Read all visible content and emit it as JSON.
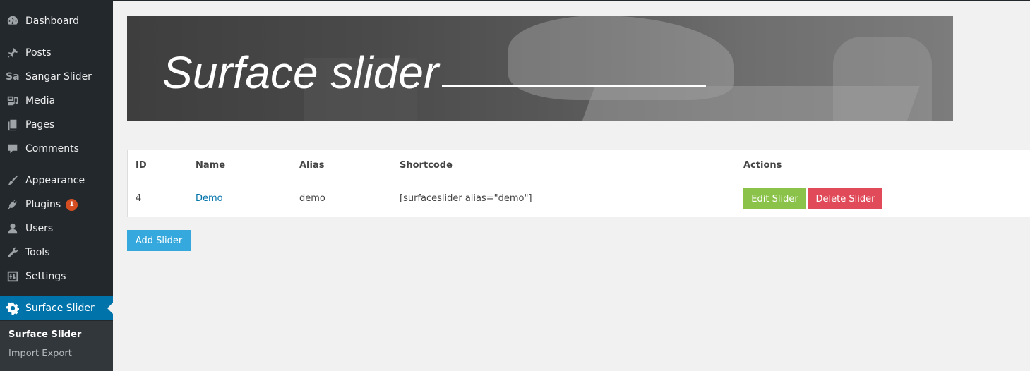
{
  "sidebar": {
    "items": [
      {
        "label": "Dashboard",
        "icon": "dashboard-icon"
      },
      {
        "label": "Posts",
        "icon": "pushpin-icon"
      },
      {
        "label": "Sangar Slider",
        "icon": "sa-text-icon",
        "icon_text": "Sa"
      },
      {
        "label": "Media",
        "icon": "media-icon"
      },
      {
        "label": "Pages",
        "icon": "pages-icon"
      },
      {
        "label": "Comments",
        "icon": "comment-icon"
      },
      {
        "label": "Appearance",
        "icon": "paintbrush-icon"
      },
      {
        "label": "Plugins",
        "icon": "plugin-icon",
        "badge": "1"
      },
      {
        "label": "Users",
        "icon": "user-icon"
      },
      {
        "label": "Tools",
        "icon": "wrench-icon"
      },
      {
        "label": "Settings",
        "icon": "settings-icon"
      },
      {
        "label": "Surface Slider",
        "icon": "gear-icon",
        "current": true
      }
    ],
    "submenu": [
      {
        "label": "Surface Slider",
        "active": true
      },
      {
        "label": "Import Export"
      }
    ]
  },
  "banner": {
    "title": "Surface slider"
  },
  "table": {
    "headers": [
      "ID",
      "Name",
      "Alias",
      "Shortcode",
      "Actions"
    ],
    "rows": [
      {
        "id": "4",
        "name": "Demo",
        "alias": "demo",
        "shortcode": "[surfaceslider alias=\"demo\"]",
        "edit_label": "Edit Slider",
        "delete_label": "Delete Slider"
      }
    ]
  },
  "add_button": "Add Slider",
  "colors": {
    "sidebar_bg": "#23282d",
    "current_bg": "#0073aa",
    "edit_btn": "#8bc34a",
    "delete_btn": "#e04a59",
    "add_btn": "#35a9dd",
    "badge": "#d54e21"
  }
}
